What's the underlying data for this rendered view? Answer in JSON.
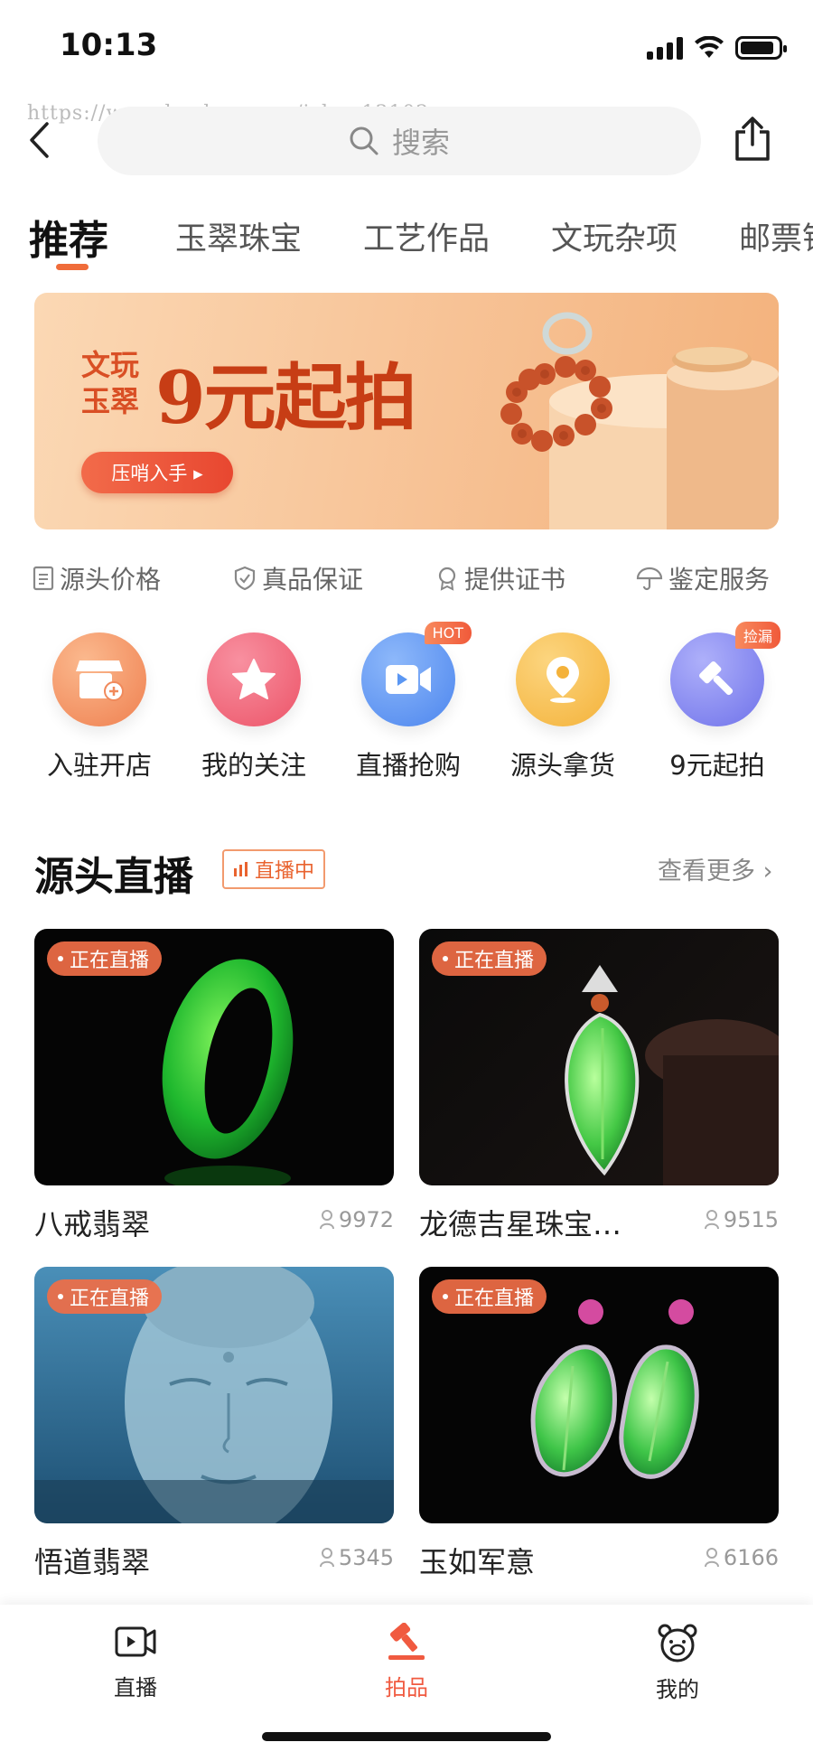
{
  "status": {
    "time": "10:13",
    "battery_level": 0.9
  },
  "watermark": "https://www.huzhan.com/ishop13102",
  "header": {
    "back_icon": "chevron-left-icon",
    "search_placeholder": "搜索",
    "share_icon": "share-icon"
  },
  "tabs": [
    {
      "label": "推荐",
      "active": true
    },
    {
      "label": "玉翠珠宝"
    },
    {
      "label": "工艺作品"
    },
    {
      "label": "文玩杂项"
    },
    {
      "label": "邮票钱币"
    }
  ],
  "banner": {
    "subtitle": "文玩玉翠",
    "title": "9元起拍",
    "button_label": "压哨入手 ▸"
  },
  "guarantees": [
    {
      "label": "源头价格",
      "icon": "document-icon"
    },
    {
      "label": "真品保证",
      "icon": "shield-check-icon"
    },
    {
      "label": "提供证书",
      "icon": "certificate-icon"
    },
    {
      "label": "鉴定服务",
      "icon": "umbrella-icon"
    }
  ],
  "entries": [
    {
      "label": "入驻开店",
      "icon": "store-icon",
      "color": "#f39a6a"
    },
    {
      "label": "我的关注",
      "icon": "star-icon",
      "color": "#f26a7a"
    },
    {
      "label": "直播抢购",
      "icon": "video-camera-icon",
      "color": "#5b97f3",
      "badge": "HOT"
    },
    {
      "label": "源头拿货",
      "icon": "location-pin-icon",
      "color": "#f7c04e"
    },
    {
      "label": "9元起拍",
      "icon": "auction-hammer-icon",
      "color": "#8a8cf0",
      "badge": "捡漏"
    }
  ],
  "live_section": {
    "title": "源头直播",
    "tag": "直播中",
    "more_label": "查看更多"
  },
  "cards": [
    {
      "name": "八戒翡翠",
      "badge": "正在直播",
      "viewers": "9972"
    },
    {
      "name": "龙德吉星珠宝…",
      "badge": "正在直播",
      "viewers": "9515"
    },
    {
      "name": "悟道翡翠",
      "badge": "正在直播",
      "viewers": "5345"
    },
    {
      "name": "玉如军意",
      "badge": "正在直播",
      "viewers": "6166"
    }
  ],
  "bottom_nav": [
    {
      "label": "直播",
      "icon": "live-video-icon"
    },
    {
      "label": "拍品",
      "icon": "auction-hammer-icon",
      "active": true
    },
    {
      "label": "我的",
      "icon": "bear-face-icon"
    }
  ],
  "colors": {
    "accent": "#f05a3a",
    "live_badge": "#f06e46"
  }
}
